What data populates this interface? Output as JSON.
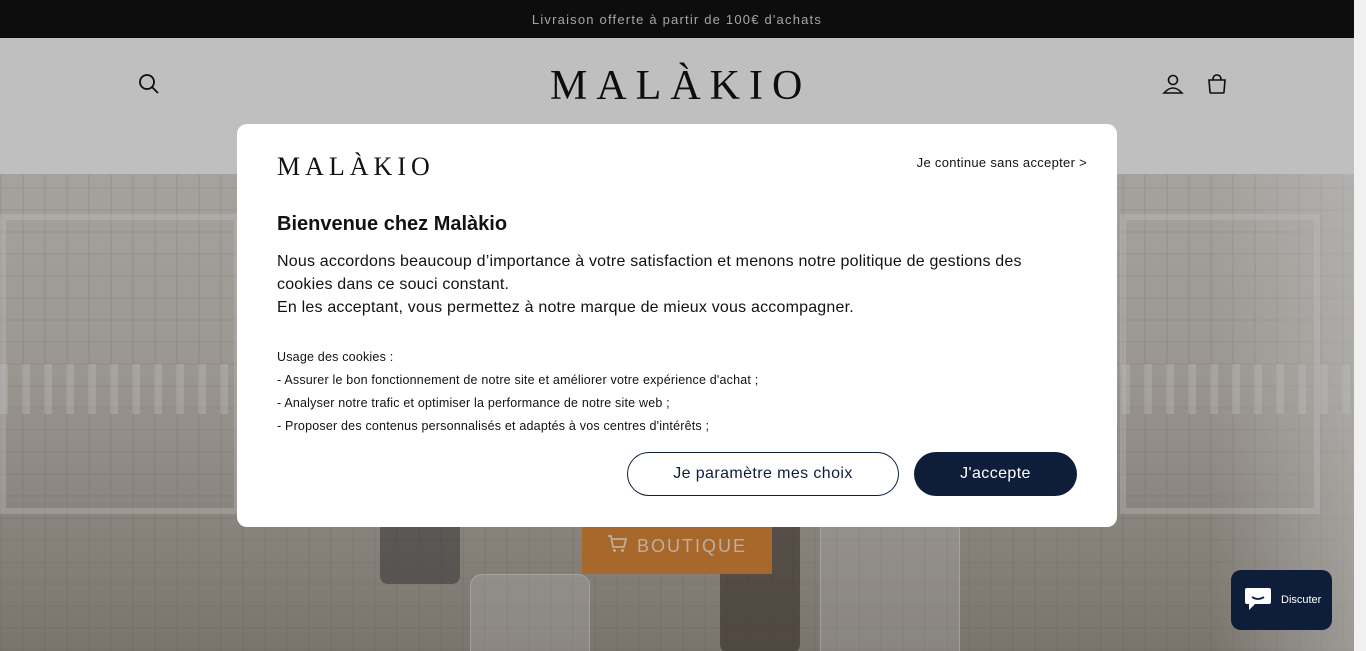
{
  "announcement": {
    "text": "Livraison offerte à partir de 100€ d'achats"
  },
  "header": {
    "logo": "MALÀKIO",
    "icons": {
      "search": "search-icon",
      "account": "account-icon",
      "cart": "cart-icon"
    }
  },
  "hero": {
    "shop_button": {
      "label": "BOUTIQUE",
      "icon": "cart-icon"
    }
  },
  "cookie_modal": {
    "logo": "MALÀKIO",
    "skip_link": "Je continue sans accepter >",
    "title": "Bienvenue chez Malàkio",
    "paragraph_1": "Nous accordons beaucoup d’importance à votre satisfaction et menons notre politique de gestions des cookies dans ce souci constant.",
    "paragraph_2": "En les acceptant, vous permettez à notre marque de mieux vous accompagner.",
    "usage_title": "Usage des cookies :",
    "usage_items": [
      "- Assurer le bon fonctionnement de notre site et améliorer votre expérience d'achat ;",
      "- Analyser notre trafic et optimiser la performance de notre site web ;",
      "- Proposer des contenus personnalisés et adaptés à vos centres d'intérêts ;"
    ],
    "settings_button": "Je paramètre mes choix",
    "accept_button": "J'accepte"
  },
  "chat_widget": {
    "label": "Discuter",
    "icon": "chat-icon"
  },
  "colors": {
    "accent": "#0e1e3a",
    "shop_button": "#e08a3a",
    "announcement_bg": "#121212"
  }
}
